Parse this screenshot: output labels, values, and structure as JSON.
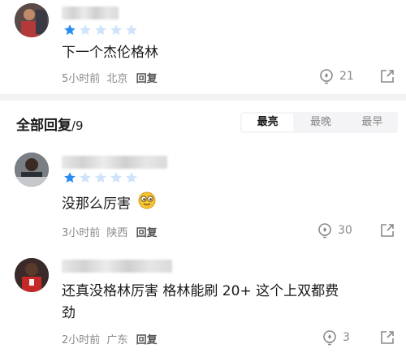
{
  "top_comment": {
    "rating": 1,
    "rating_max": 5,
    "text": "下一个杰伦格林",
    "time": "5小时前",
    "location": "北京",
    "reply_label": "回复",
    "likes": "21"
  },
  "replies_header": {
    "title": "全部回复",
    "count": "/9",
    "sort_options": [
      "最亮",
      "最晚",
      "最早"
    ],
    "active_sort": "最亮"
  },
  "replies": [
    {
      "rating": 1,
      "rating_max": 5,
      "text": "没那么厉害",
      "emoji": "smug-face-emoji",
      "time": "3小时前",
      "location": "陕西",
      "reply_label": "回复",
      "likes": "30"
    },
    {
      "text_line1": "还真没格林厉害 格林能刷 20+ 这个上双都费",
      "text_line2": "劲",
      "time": "2小时前",
      "location": "广东",
      "reply_label": "回复",
      "likes": "3"
    }
  ],
  "colors": {
    "star_filled": "#2a8cf0",
    "star_empty": "#cfe3fb",
    "meta_text": "#8a8a8a",
    "divider": "#f2f2f4"
  },
  "icons": {
    "like": "lightbulb-like-icon",
    "share": "share-icon"
  }
}
